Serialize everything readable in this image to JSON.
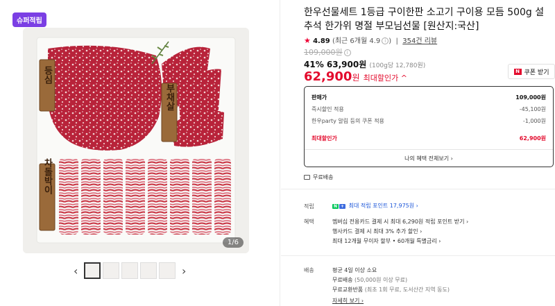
{
  "gallery": {
    "badge": "슈퍼적립",
    "counter": "1/6",
    "label_dong": "등심",
    "label_buchae": "부채살",
    "label_chadol": "차돌박이",
    "prev": "‹",
    "next": "›"
  },
  "product": {
    "title": "한우선물세트 1등급 구이한판 소고기 구이용 모듬 500g 설 추석 한가위 명절 부모님선물 [원산지:국산]",
    "rating_star": "★",
    "rating_score": "4.89",
    "rating_recent": "(최근 6개월 4.9",
    "rating_recent_close": ")",
    "review_count": "354건 리뷰",
    "original_price": "109,000원",
    "discount_rate": "41%",
    "sale_price": "63,900원",
    "unit_price": "(100g당 12,780원)",
    "max_price_num": "62,900",
    "max_price_won": "원",
    "max_price_label": "최대할인가 ^",
    "coupon_label": "쿠폰 받기",
    "coupon_icon": "N"
  },
  "price_box": {
    "rows": [
      {
        "label": "판매가",
        "value": "109,000원"
      },
      {
        "label": "즉시할인 적용",
        "value": "-45,100원"
      },
      {
        "label": "한우party 알림 등의 쿠폰 적용",
        "value": "-1,000원"
      },
      {
        "label": "최대할인가",
        "value": "62,900원"
      }
    ],
    "link": "나의 혜택 전체보기 ›"
  },
  "shipping": {
    "free": "무료배송"
  },
  "points": {
    "label": "적립",
    "npay": "N",
    "plus": "+",
    "shop": "스토어",
    "text": "최대 적립 포인트 17,975원 ›"
  },
  "benefits": {
    "label": "혜택",
    "items": [
      "멤버십 전용카드 결제 시 최대 6,290원 적립 포인트 받기 ›",
      "행사카드 결제 시 최대 3% 추가 할인 ›",
      "최대 12개월 무이자 할부 • 60개월 특별금리 ›"
    ]
  },
  "delivery": {
    "label": "배송",
    "line1": "평균 4일 이상 소요",
    "line2_a": "무료배송",
    "line2_b": "(50,000원 이상 무료)",
    "line3_a": "무료교환반품",
    "line3_b": "(최초 1회 무료, 도서산간 지역 동도)",
    "more": "자세히 보기 ›"
  },
  "colors": {
    "accent_red": "#e30b2d",
    "badge_purple": "#7b3fe4",
    "npay_green": "#03c75a",
    "point_blue": "#1a54d8"
  }
}
